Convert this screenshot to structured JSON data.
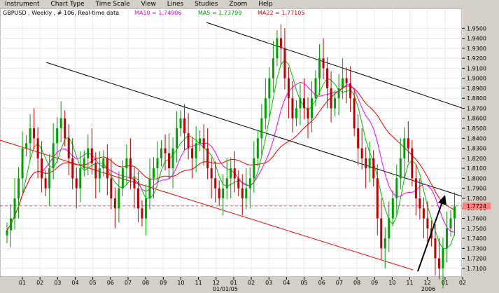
{
  "menu": [
    "Instrument",
    "Chart Type",
    "Time Scale",
    "View",
    "Lines",
    "Studies",
    "Zoom",
    "Help"
  ],
  "header": {
    "symbol_info": "GBPUSD , Weekly , # 106, Real-time data",
    "ma10": "MA10 = 1.74906",
    "ma5": "MA5 = 1.73799",
    "ma22": "MA22 = 1.77105"
  },
  "colors": {
    "up_candle": "#00a000",
    "down_candle": "#c00000",
    "ma10": "#ff00ff",
    "ma5": "#00c000",
    "ma22": "#ff0000",
    "channel_lines": "#000000",
    "lower_line": "#ff0000",
    "price_line": "#ff4040",
    "axis_bg": "#d4d0c8"
  },
  "y_axis": {
    "labels": [
      "1.9500",
      "1.9400",
      "1.9300",
      "1.9200",
      "1.9100",
      "1.9000",
      "1.8900",
      "1.8800",
      "1.8700",
      "1.8600",
      "1.8500",
      "1.8400",
      "1.8300",
      "1.8200",
      "1.8100",
      "1.8000",
      "1.7900",
      "1.7800",
      "1.7700",
      "1.7600",
      "1.7500",
      "1.7400",
      "1.7300",
      "1.7200",
      "1.7100"
    ],
    "current_price": "1.7724"
  },
  "x_axis": {
    "labels": [
      "01",
      "02",
      "03",
      "04",
      "05",
      "06",
      "07",
      "08",
      "09",
      "10",
      "11",
      "12",
      "01",
      "02",
      "03",
      "04",
      "05",
      "06",
      "07",
      "08",
      "09",
      "10",
      "11",
      "12",
      "01",
      "02"
    ],
    "year_labels": [
      "01/01/05",
      "2006"
    ]
  },
  "chart_data": {
    "type": "candlestick",
    "timeframe": "Weekly",
    "ylim": [
      1.705,
      1.96
    ],
    "current_price": 1.7724,
    "candles_close": [
      1.748,
      1.76,
      1.78,
      1.8,
      1.83,
      1.835,
      1.85,
      1.84,
      1.82,
      1.8,
      1.79,
      1.81,
      1.835,
      1.85,
      1.86,
      1.84,
      1.82,
      1.8,
      1.79,
      1.81,
      1.82,
      1.83,
      1.815,
      1.8,
      1.81,
      1.82,
      1.8,
      1.78,
      1.77,
      1.79,
      1.81,
      1.82,
      1.8,
      1.79,
      1.77,
      1.76,
      1.78,
      1.8,
      1.81,
      1.82,
      1.83,
      1.825,
      1.81,
      1.83,
      1.85,
      1.86,
      1.845,
      1.83,
      1.82,
      1.835,
      1.84,
      1.83,
      1.81,
      1.8,
      1.79,
      1.78,
      1.79,
      1.8,
      1.81,
      1.8,
      1.79,
      1.78,
      1.79,
      1.8,
      1.82,
      1.84,
      1.86,
      1.88,
      1.9,
      1.92,
      1.94,
      1.93,
      1.9,
      1.88,
      1.86,
      1.87,
      1.88,
      1.87,
      1.86,
      1.88,
      1.9,
      1.92,
      1.91,
      1.89,
      1.87,
      1.88,
      1.89,
      1.9,
      1.895,
      1.88,
      1.85,
      1.83,
      1.82,
      1.81,
      1.82,
      1.8,
      1.76,
      1.73,
      1.74,
      1.76,
      1.78,
      1.8,
      1.82,
      1.84,
      1.83,
      1.8,
      1.78,
      1.77,
      1.76,
      1.75,
      1.74,
      1.72,
      1.71,
      1.73,
      1.75,
      1.76,
      1.772
    ]
  }
}
